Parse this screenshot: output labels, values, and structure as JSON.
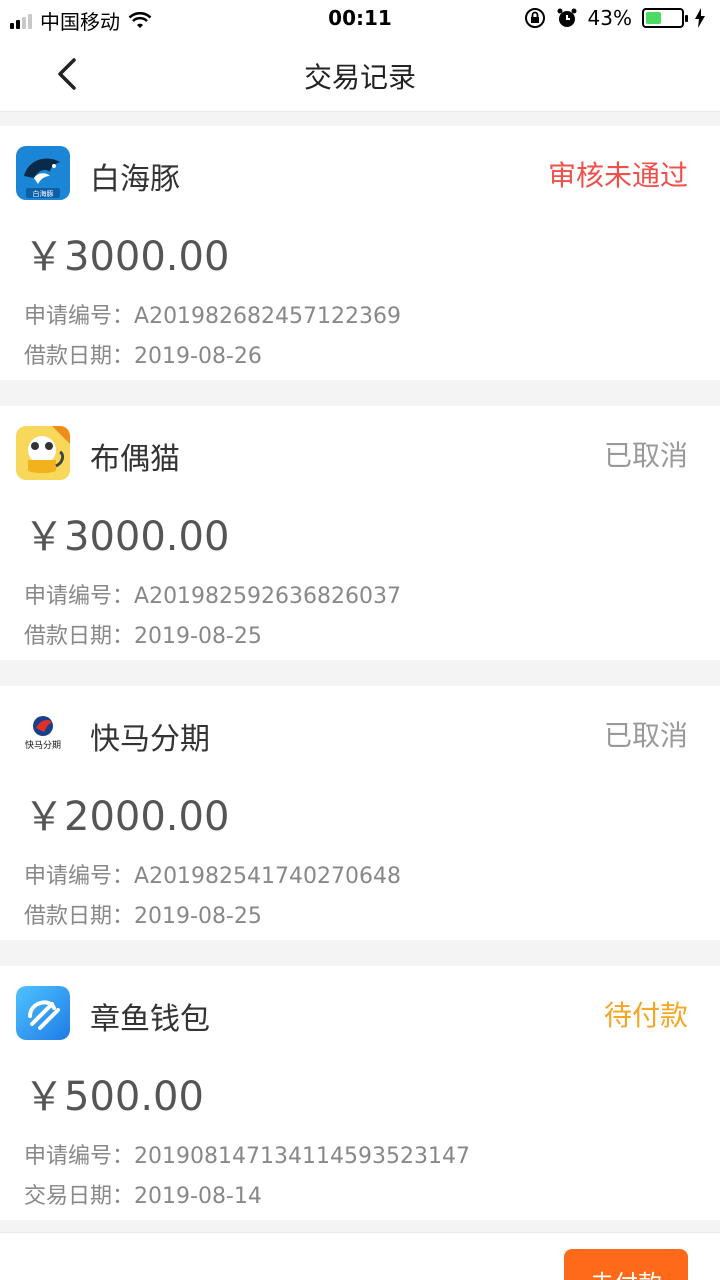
{
  "statusbar": {
    "carrier": "中国移动",
    "time": "00:11",
    "battery": "43%",
    "battery_level": 0.43
  },
  "navbar": {
    "title": "交易记录"
  },
  "records": [
    {
      "name": "白海豚",
      "status": "审核未通过",
      "status_color": "#f0504b",
      "amount": "￥3000.00",
      "line1_label": "申请编号：",
      "line1_value": "A201982682457122369",
      "line2_label": "借款日期：",
      "line2_value": "2019-08-26",
      "logo_text": "白海豚",
      "logo_icon": "dolphin-logo-icon"
    },
    {
      "name": "布偶猫",
      "status": "已取消",
      "status_color": "#999999",
      "amount": "￥3000.00",
      "line1_label": "申请编号：",
      "line1_value": "A201982592636826037",
      "line2_label": "借款日期：",
      "line2_value": "2019-08-25",
      "logo_icon": "cat-logo-icon"
    },
    {
      "name": "快马分期",
      "status": "已取消",
      "status_color": "#999999",
      "amount": "￥2000.00",
      "line1_label": "申请编号：",
      "line1_value": "A201982541740270648",
      "line2_label": "借款日期：",
      "line2_value": "2019-08-25",
      "logo_text": "快马分期",
      "logo_icon": "horse-logo-icon"
    },
    {
      "name": "章鱼钱包",
      "status": "待付款",
      "status_color": "#f5a623",
      "amount": "￥500.00",
      "line1_label": "申请编号：",
      "line1_value": "201908147134114593523147",
      "line2_label": "交易日期：",
      "line2_value": "2019-08-14",
      "logo_icon": "octopus-logo-icon"
    }
  ],
  "bottom": {
    "pay_label": "去付款"
  }
}
